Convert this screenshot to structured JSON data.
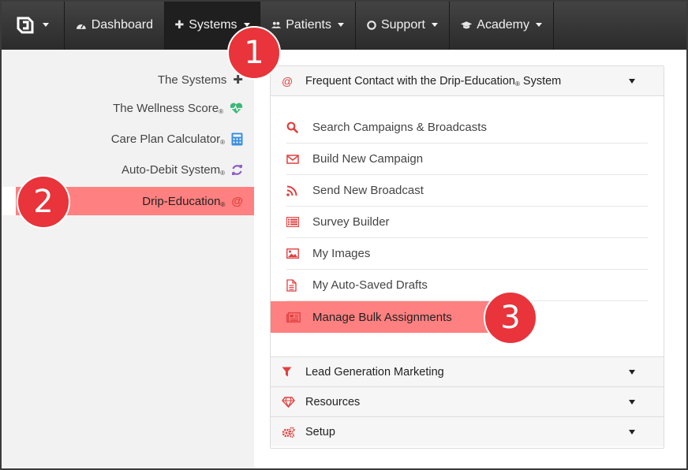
{
  "nav": {
    "items": [
      {
        "label": "Dashboard",
        "icon": "dashboard-icon"
      },
      {
        "label": "Systems",
        "icon": "puzzle-icon"
      },
      {
        "label": "Patients",
        "icon": "users-icon"
      },
      {
        "label": "Support",
        "icon": "lifebuoy-icon"
      },
      {
        "label": "Academy",
        "icon": "graduation-cap-icon"
      }
    ]
  },
  "sidebar": {
    "items": [
      {
        "label": "The Systems",
        "reg": "",
        "icon": "puzzle-icon",
        "color": "#444444"
      },
      {
        "label": "The Wellness Score",
        "reg": "®",
        "icon": "heartbeat-icon",
        "color": "#3cb878"
      },
      {
        "label": "Care Plan Calculator",
        "reg": "®",
        "icon": "calculator-icon",
        "color": "#3a8ee0"
      },
      {
        "label": "Auto-Debit System",
        "reg": "®",
        "icon": "refresh-icon",
        "color": "#8e5fc4"
      },
      {
        "label": "Drip-Education",
        "reg": "®",
        "icon": "at-icon",
        "color": "#e04040"
      }
    ]
  },
  "panel": {
    "header": {
      "label": "Frequent Contact with the Drip-Education",
      "reg": "®",
      "label_tail": " System"
    },
    "menu": [
      {
        "label": "Search Campaigns & Broadcasts",
        "icon": "search-icon"
      },
      {
        "label": "Build New Campaign",
        "icon": "envelope-icon"
      },
      {
        "label": "Send New Broadcast",
        "icon": "rss-icon"
      },
      {
        "label": "Survey Builder",
        "icon": "list-icon"
      },
      {
        "label": "My Images",
        "icon": "image-icon"
      },
      {
        "label": "My Auto-Saved Drafts",
        "icon": "file-icon"
      },
      {
        "label": "Manage Bulk Assignments",
        "icon": "newspaper-icon"
      }
    ],
    "sections": [
      {
        "label": "Lead Generation Marketing",
        "icon": "filter-icon"
      },
      {
        "label": "Resources",
        "icon": "diamond-icon"
      },
      {
        "label": "Setup",
        "icon": "cogs-icon"
      }
    ]
  },
  "badges": [
    "1",
    "2",
    "3"
  ],
  "colors": {
    "accent": "#e04040",
    "highlight": "#ff8080",
    "badge": "#e8343a"
  }
}
